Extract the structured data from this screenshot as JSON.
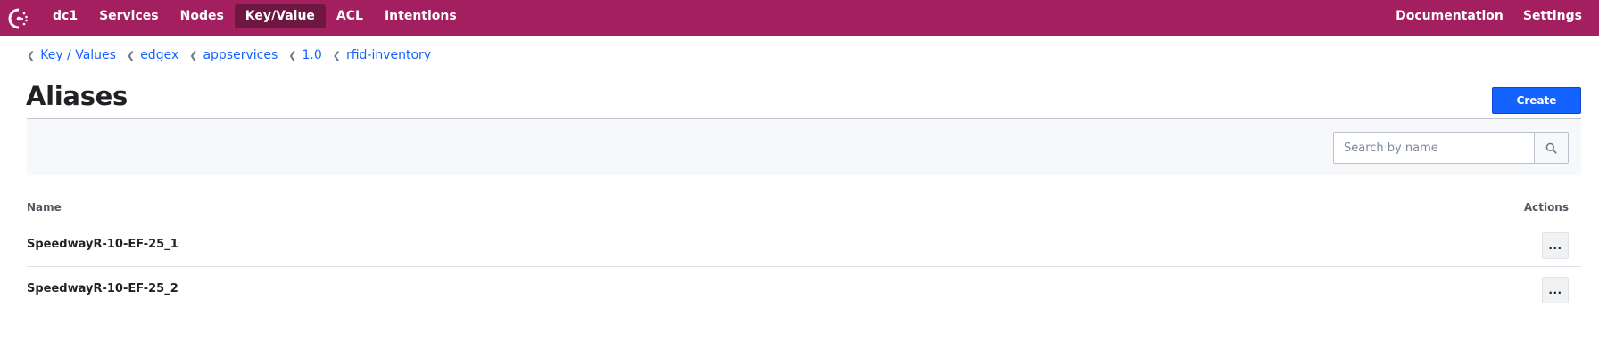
{
  "nav": {
    "logo_icon": "consul-logo-icon",
    "datacenter": "dc1",
    "items": [
      {
        "label": "Services",
        "active": false
      },
      {
        "label": "Nodes",
        "active": false
      },
      {
        "label": "Key/Value",
        "active": true
      },
      {
        "label": "ACL",
        "active": false
      },
      {
        "label": "Intentions",
        "active": false
      }
    ],
    "right": [
      {
        "label": "Documentation"
      },
      {
        "label": "Settings"
      }
    ],
    "color": "#a31f5f"
  },
  "breadcrumbs": [
    "Key / Values",
    "edgex",
    "appservices",
    "1.0",
    "rfid-inventory"
  ],
  "page": {
    "title": "Aliases",
    "create_label": "Create"
  },
  "search": {
    "placeholder": "Search by name",
    "value": "",
    "icon": "search-icon"
  },
  "table": {
    "headers": {
      "name": "Name",
      "actions": "Actions"
    },
    "rows": [
      {
        "name": "SpeedwayR-10-EF-25_1",
        "actions_label": "..."
      },
      {
        "name": "SpeedwayR-10-EF-25_2",
        "actions_label": "..."
      }
    ]
  },
  "colors": {
    "accent": "#1563ff",
    "nav_active": "#6e1741"
  }
}
